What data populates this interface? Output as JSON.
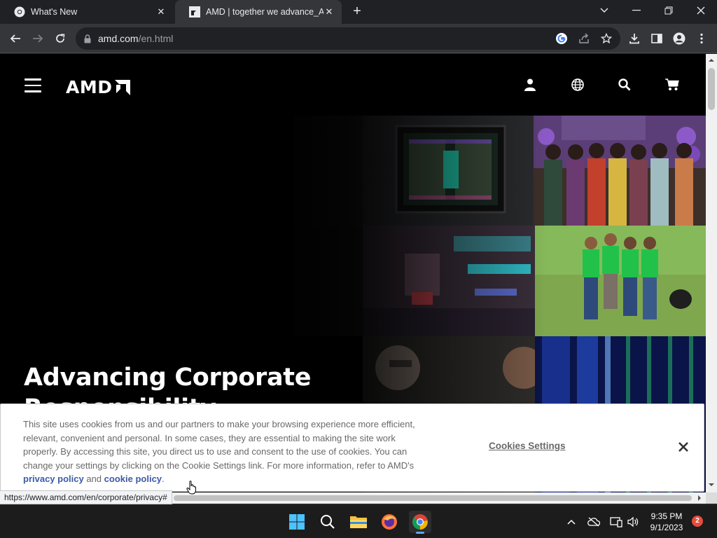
{
  "browser": {
    "tabs": [
      {
        "title": "What's New",
        "active": false
      },
      {
        "title": "AMD | together we advance_AI",
        "active": true
      }
    ],
    "url": {
      "host": "amd.com",
      "path": "/en.html"
    }
  },
  "site": {
    "logo_text": "AMD",
    "hero_title": "Advancing Corporate Responsibility"
  },
  "cookie_banner": {
    "text_before": "This site uses cookies from us and our partners to make your browsing experience more efficient, relevant, convenient and personal. In some cases, they are essential to making the site work properly. By accessing this site, you direct us to use and consent to the use of cookies. You can change your settings by clicking on the Cookie Settings link. For more information, refer to AMD's",
    "privacy_link": "privacy policy",
    "and_text": "and",
    "cookie_link": "cookie policy",
    "end_punct": ".",
    "settings_label": "Cookies Settings"
  },
  "status_url": "https://www.amd.com/en/corporate/privacy#",
  "taskbar": {
    "time": "9:35 PM",
    "date": "9/1/2023",
    "notification_count": "2"
  },
  "colors": {
    "link": "#3c5aa8",
    "page_bg": "#000000",
    "chrome_bg": "#202124"
  }
}
